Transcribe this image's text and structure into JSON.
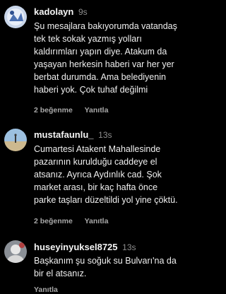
{
  "comments": [
    {
      "username": "kadolayn",
      "time": "9s",
      "text_lines": [
        "Şu mesajlara bakıyorumda vatandaş",
        "tek tek sokak yazmış yolları",
        "kaldırımları yapın diye. Atakum da",
        "yaşayan herkesin haberi var her yer",
        "berbat durumda. Ama belediyenin",
        "haberi yok. Çok tuhaf değilmi"
      ],
      "likes": "2 beğenme",
      "reply": "Yanıtla"
    },
    {
      "username": "mustafaunlu_",
      "time": "13s",
      "text_lines": [
        "Cumartesi Atakent Mahallesinde",
        "pazarının kurulduğu caddeye el",
        "atsanız. Ayrıca Aydınlık cad. Şok",
        "market arası, bir kaç hafta önce",
        "parke taşları düzeltildi yol yine çöktü."
      ],
      "likes": "2 beğenme",
      "reply": "Yanıtla"
    },
    {
      "username": "huseyinyuksel8725",
      "time": "13s",
      "text_lines": [
        "Başkanım şu soğuk su Bulvarı'na da",
        "bir el atsanız."
      ],
      "reply": "Yanıtla"
    }
  ]
}
